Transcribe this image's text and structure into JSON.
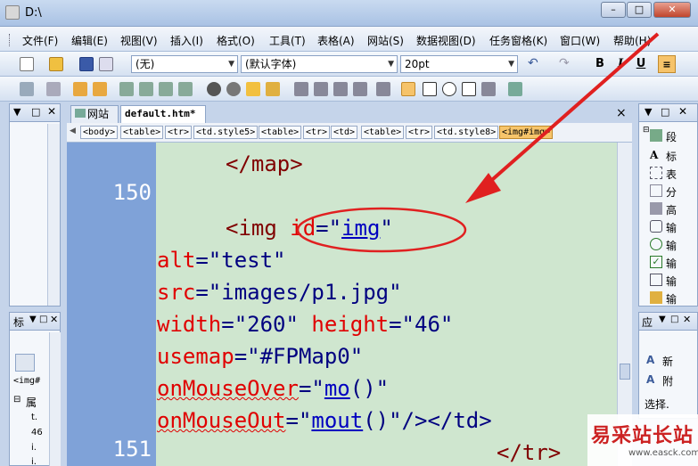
{
  "window": {
    "title": "D:\\",
    "controls": {
      "minimize": "–",
      "maximize": "□",
      "close": "✕"
    }
  },
  "menu": [
    "文件(F)",
    "编辑(E)",
    "视图(V)",
    "插入(I)",
    "格式(O)",
    "工具(T)",
    "表格(A)",
    "网站(S)",
    "数据视图(D)",
    "任务窗格(K)",
    "窗口(W)",
    "帮助(H)"
  ],
  "format_toolbar": {
    "style_value": "(无)",
    "font_value": "(默认字体)",
    "size_value": "20pt",
    "bold": "B",
    "italic": "I",
    "underline": "U"
  },
  "left_panel": {
    "bottom_tab": "标",
    "element_label": "<img#",
    "tree_label": "属",
    "tree_items": [
      "t.",
      "46",
      "i.",
      "i."
    ]
  },
  "document_tabs": [
    "网站",
    "default.htm*"
  ],
  "close_glyph": "×",
  "breadcrumbs": [
    "<body>",
    "<table>",
    "<tr>",
    "<td.style5>",
    "<table>",
    "<tr>",
    "<td>",
    "<table>",
    "<tr>",
    "<td.style8>",
    "<img#img>"
  ],
  "code": {
    "line_numbers": [
      "150",
      "151"
    ],
    "lines": {
      "map_close": "</map>",
      "img_open": "<img",
      "id_attr": "id",
      "id_eq": "=\"",
      "id_value": "img",
      "id_end": "\"",
      "alt_attr": "alt",
      "alt_rest": "=\"test\"",
      "src_attr": "src",
      "src_rest": "=\"images/p1.jpg\"",
      "width_attr": "width",
      "width_rest": "=\"260\"",
      "height_attr": "height",
      "height_rest": "=\"46\"",
      "usemap_attr": "usemap",
      "usemap_rest": "=\"#FPMap0\"",
      "over_attr": "onMouseOver",
      "over_eq": "=\"",
      "over_fn": "mo",
      "over_rest": "()\"",
      "out_attr": "onMouseOut",
      "out_eq": "=\"",
      "out_fn": "mout",
      "out_rest": "()\"/></td>",
      "tr_close": "</tr>"
    }
  },
  "right_panel": {
    "toolbox_items": [
      "段",
      "标",
      "表",
      "分",
      "高",
      "输",
      "输",
      "输",
      "输",
      "输"
    ],
    "bottom_tab": "应",
    "bottom_items": [
      "新",
      "附",
      "选择."
    ]
  },
  "watermark": {
    "main": "易采站长站",
    "sub": "www.easck.com"
  },
  "colors": {
    "annotation": "#e02020",
    "gutter": "#7fa2d8",
    "editor_bg": "#cfe6cf"
  }
}
